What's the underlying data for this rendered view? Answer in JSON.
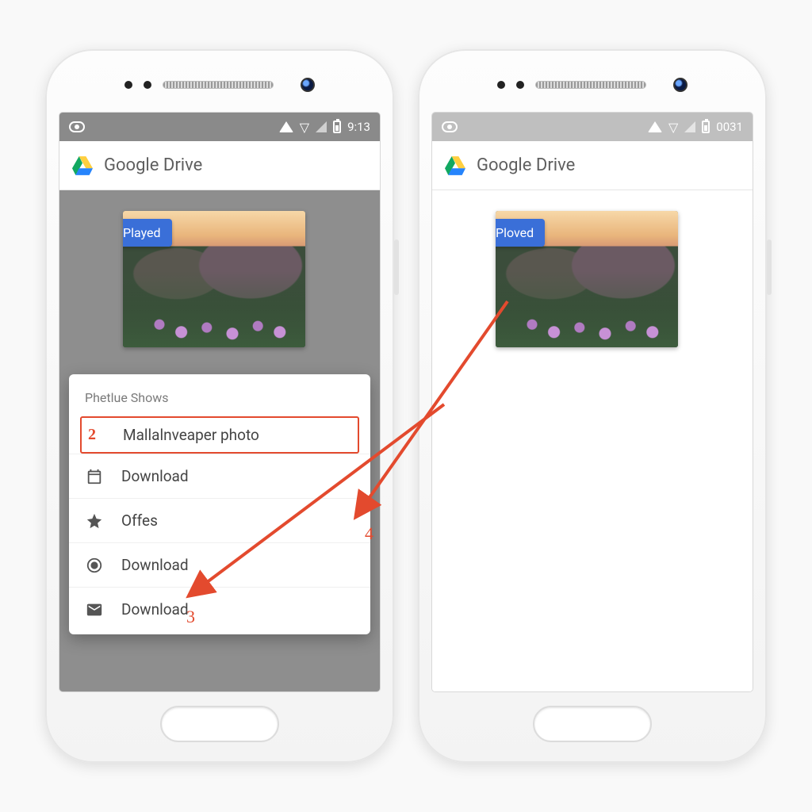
{
  "left": {
    "statusbar_time": "9:13",
    "app_title": "Google Drive",
    "thumb_badge": "Played",
    "sheet": {
      "title": "Phetlue Shows",
      "items": [
        {
          "num": "2",
          "label": "Mallalnveaper photo",
          "icon": null,
          "highlight": true
        },
        {
          "icon": "calendar",
          "label": "Download"
        },
        {
          "icon": "star",
          "label": "Offes"
        },
        {
          "icon": "target",
          "label": "Download"
        },
        {
          "icon": "mail",
          "label": "Download"
        }
      ]
    }
  },
  "right": {
    "statusbar_time": "0031",
    "app_title": "Google Drive",
    "thumb_badge": "Ploved"
  },
  "annotations": {
    "num3": "3",
    "num4": "4"
  }
}
